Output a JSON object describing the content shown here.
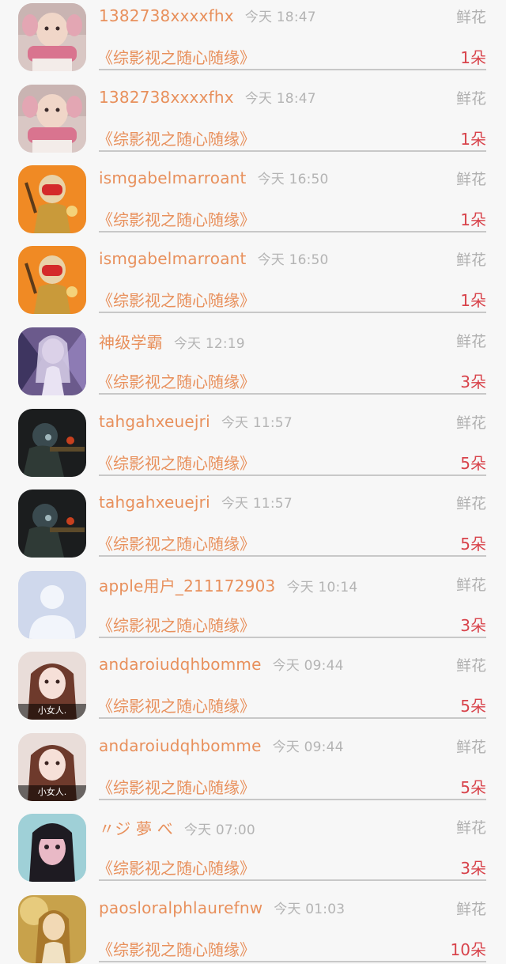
{
  "gift_records": [
    {
      "avatar": "baby-photo-avatar",
      "name": "1382738xxxxfhx",
      "time": "今天 18:47",
      "gift": "鲜花",
      "book": "《综影视之随心随缘》",
      "count": "1朵"
    },
    {
      "avatar": "baby-photo-avatar",
      "name": "1382738xxxxfhx",
      "time": "今天 18:47",
      "gift": "鲜花",
      "book": "《综影视之随心随缘》",
      "count": "1朵"
    },
    {
      "avatar": "armored-warrior-avatar",
      "name": "ismgabelmarroant",
      "time": "今天 16:50",
      "gift": "鲜花",
      "book": "《综影视之随心随缘》",
      "count": "1朵"
    },
    {
      "avatar": "armored-warrior-avatar",
      "name": "ismgabelmarroant",
      "time": "今天 16:50",
      "gift": "鲜花",
      "book": "《综影视之随心随缘》",
      "count": "1朵"
    },
    {
      "avatar": "anime-girl-avatar",
      "name": "神级学霸",
      "time": "今天 12:19",
      "gift": "鲜花",
      "book": "《综影视之随心随缘》",
      "count": "3朵"
    },
    {
      "avatar": "soldier-sniper-avatar",
      "name": "tahgahxeuejri",
      "time": "今天 11:57",
      "gift": "鲜花",
      "book": "《综影视之随心随缘》",
      "count": "5朵"
    },
    {
      "avatar": "soldier-sniper-avatar",
      "name": "tahgahxeuejri",
      "time": "今天 11:57",
      "gift": "鲜花",
      "book": "《综影视之随心随缘》",
      "count": "5朵"
    },
    {
      "avatar": "default-user-avatar",
      "name": "apple用户_211172903",
      "time": "今天 10:14",
      "gift": "鲜花",
      "book": "《综影视之随心随缘》",
      "count": "3朵"
    },
    {
      "avatar": "girl-photo-avatar",
      "avatar_caption": "小女人.",
      "name": "andaroiudqhbomme",
      "time": "今天 09:44",
      "gift": "鲜花",
      "book": "《综影视之随心随缘》",
      "count": "5朵"
    },
    {
      "avatar": "girl-photo-avatar",
      "avatar_caption": "小女人.",
      "name": "andaroiudqhbomme",
      "time": "今天 09:44",
      "gift": "鲜花",
      "book": "《综影视之随心随缘》",
      "count": "5朵"
    },
    {
      "avatar": "dark-hair-girl-avatar",
      "name": "〃ジ 夢 べ",
      "time": "今天 07:00",
      "gift": "鲜花",
      "book": "《综影视之随心随缘》",
      "count": "3朵"
    },
    {
      "avatar": "golden-portrait-avatar",
      "name": "paosloralphlaurefnw",
      "time": "今天 01:03",
      "gift": "鲜花",
      "book": "《综影视之随心随缘》",
      "count": "10朵"
    }
  ]
}
